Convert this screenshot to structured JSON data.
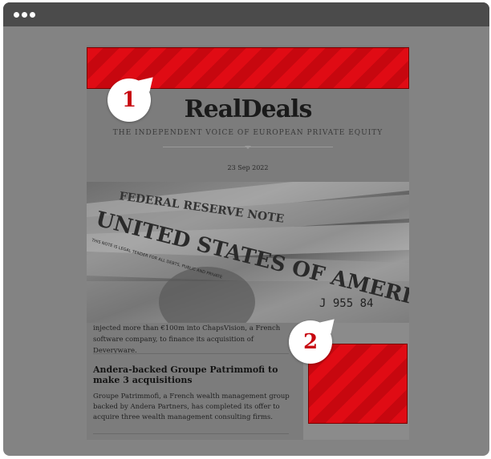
{
  "window": {
    "controls": [
      "dot",
      "dot",
      "dot"
    ]
  },
  "email": {
    "brand": {
      "logo_text": "RealDeals",
      "tagline": "THE INDEPENDENT VOICE OF EUROPEAN PRIVATE EQUITY"
    },
    "date": "23 Sep 2022",
    "hero_image": {
      "texts": [
        "UNITED STATES OF AMERICA",
        "FEDERAL RESERVE NOTE",
        "THIS NOTE IS LEGAL TENDER FOR ALL DEBTS, PUBLIC AND PRIVATE",
        "J 955 84"
      ]
    },
    "articles": [
      {
        "snippet": "injected more than €100m into ChapsVision, a French software company, to finance its acquisition of Deveryware."
      },
      {
        "headline": "Andera-backed Groupe Patrimmofi to make 3 acquisitions",
        "body": "Groupe Patrimmofi, a French wealth management group backed by Andera Partners, has completed its offer to acquire three wealth management consulting firms."
      }
    ]
  },
  "annotations": {
    "badge_1": "1",
    "badge_2": "2"
  },
  "colors": {
    "accent": "#e00b14",
    "window_chrome": "#4b4b4b",
    "overlay": "#838383",
    "badge_text": "#c7070f"
  }
}
